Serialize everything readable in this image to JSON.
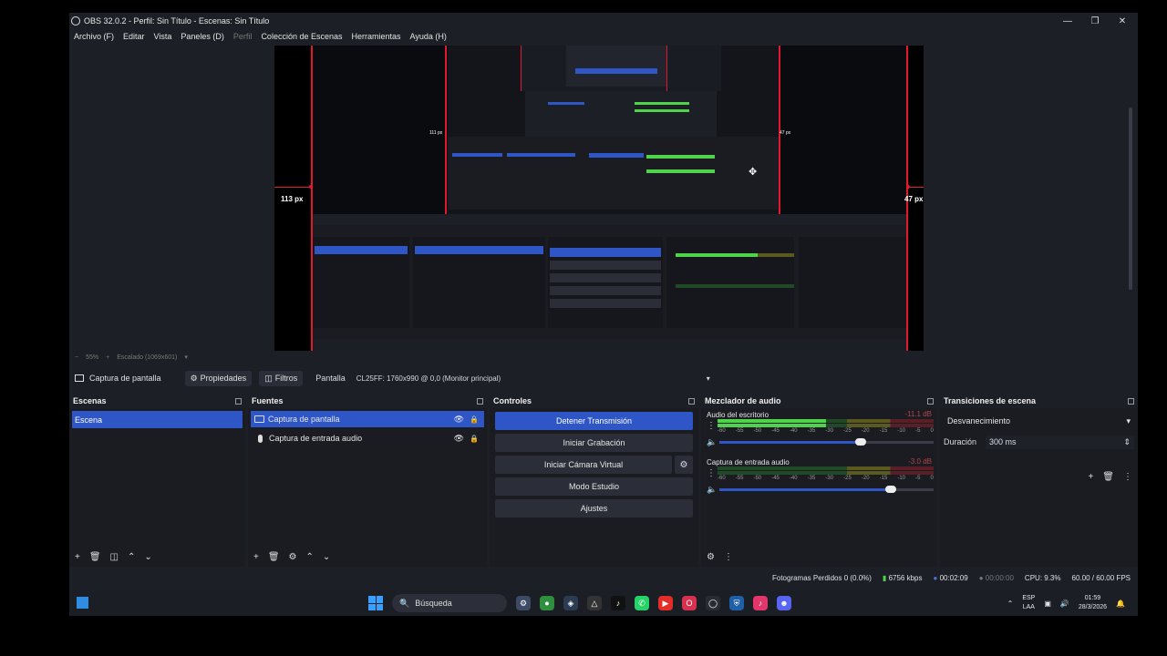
{
  "window": {
    "title": "OBS 32.0.2 - Perfil: Sin Título - Escenas: Sin Título",
    "controls": [
      "minimize",
      "maximize",
      "close"
    ]
  },
  "menu": [
    {
      "label": "Archivo (F)",
      "disabled": false
    },
    {
      "label": "Editar",
      "disabled": false
    },
    {
      "label": "Vista",
      "disabled": false
    },
    {
      "label": "Paneles (D)",
      "disabled": false
    },
    {
      "label": "Perfil",
      "disabled": true
    },
    {
      "label": "Colección de Escenas",
      "disabled": false
    },
    {
      "label": "Herramientas",
      "disabled": false
    },
    {
      "label": "Ayuda (H)",
      "disabled": false
    }
  ],
  "preview": {
    "left_distance": "113 px",
    "right_distance": "47 px",
    "nested_left_distance": "111 px",
    "nested_right_distance": "47 px",
    "zoom": "55%",
    "scaled": "Escalado (1069x601)"
  },
  "source_toolbar": {
    "selected_source": "Captura de pantalla",
    "properties": "Propiedades",
    "filters": "Filtros",
    "display_label": "Pantalla",
    "display_value": "CL25FF: 1760x990 @ 0,0 (Monitor principal)"
  },
  "scenes": {
    "title": "Escenas",
    "items": [
      "Escena"
    ]
  },
  "sources": {
    "title": "Fuentes",
    "items": [
      {
        "label": "Captura de pantalla",
        "icon": "monitor-icon"
      },
      {
        "label": "Captura de entrada audio",
        "icon": "microphone-icon"
      }
    ]
  },
  "controls": {
    "title": "Controles",
    "stop_stream": "Detener Transmisión",
    "start_recording": "Iniciar Grabación",
    "virtual_camera": "Iniciar Cámara Virtual",
    "studio_mode": "Modo Estudio",
    "settings": "Ajustes"
  },
  "mixer": {
    "title": "Mezclador de audio",
    "channels": [
      {
        "name": "Audio del escritorio",
        "db": "-11.1 dB",
        "level": 0.5,
        "peak": 0.67,
        "volume": 0.66
      },
      {
        "name": "Captura de entrada audio",
        "db": "-3.0 dB",
        "level": 0.0,
        "peak": 0.0,
        "volume": 0.8
      }
    ],
    "ticks": [
      "-60",
      "-55",
      "-50",
      "-45",
      "-40",
      "-35",
      "-30",
      "-25",
      "-20",
      "-15",
      "-10",
      "-5",
      "0"
    ]
  },
  "transitions": {
    "title": "Transiciones de escena",
    "selected": "Desvanecimiento",
    "duration_label": "Duración",
    "duration_value": "300 ms"
  },
  "status": {
    "dropped": "Fotogramas Perdidos 0 (0.0%)",
    "kbps": "6756 kbps",
    "stream_time": "00:02:09",
    "rec_time": "00:00:00",
    "cpu": "CPU: 9.3%",
    "fps": "60.00 / 60.00 FPS"
  },
  "taskbar": {
    "search": "Búsqueda",
    "lang_top": "ESP",
    "lang_bottom": "LAA",
    "time": "01:59",
    "date": "28/3/2026"
  },
  "colors": {
    "accent": "#2f56c7",
    "guide_red": "#e0192d",
    "meter_green": "#4fd34a"
  }
}
